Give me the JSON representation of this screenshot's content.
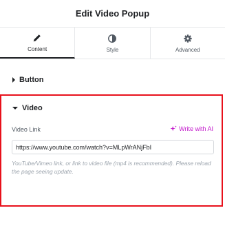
{
  "header": {
    "title": "Edit Video Popup"
  },
  "tabs": [
    {
      "label": "Content",
      "icon": "pencil-icon",
      "active": true
    },
    {
      "label": "Style",
      "icon": "half-circle-icon",
      "active": false
    },
    {
      "label": "Advanced",
      "icon": "gear-icon",
      "active": false
    }
  ],
  "sections": {
    "button": {
      "title": "Button"
    },
    "video": {
      "title": "Video",
      "field_label": "Video Link",
      "ai_link": "Write with AI",
      "url_value": "https://www.youtube.com/watch?v=MLpWrANjFbI",
      "help_text": "YouTube/Vimeo link, or link to video file (mp4 is recommended). Please reload the page seeing update."
    }
  },
  "colors": {
    "highlight_border": "#e8101b",
    "ai_accent": "#c31bcc",
    "text_dark": "#1f2124",
    "help_text": "#9da5ae"
  }
}
